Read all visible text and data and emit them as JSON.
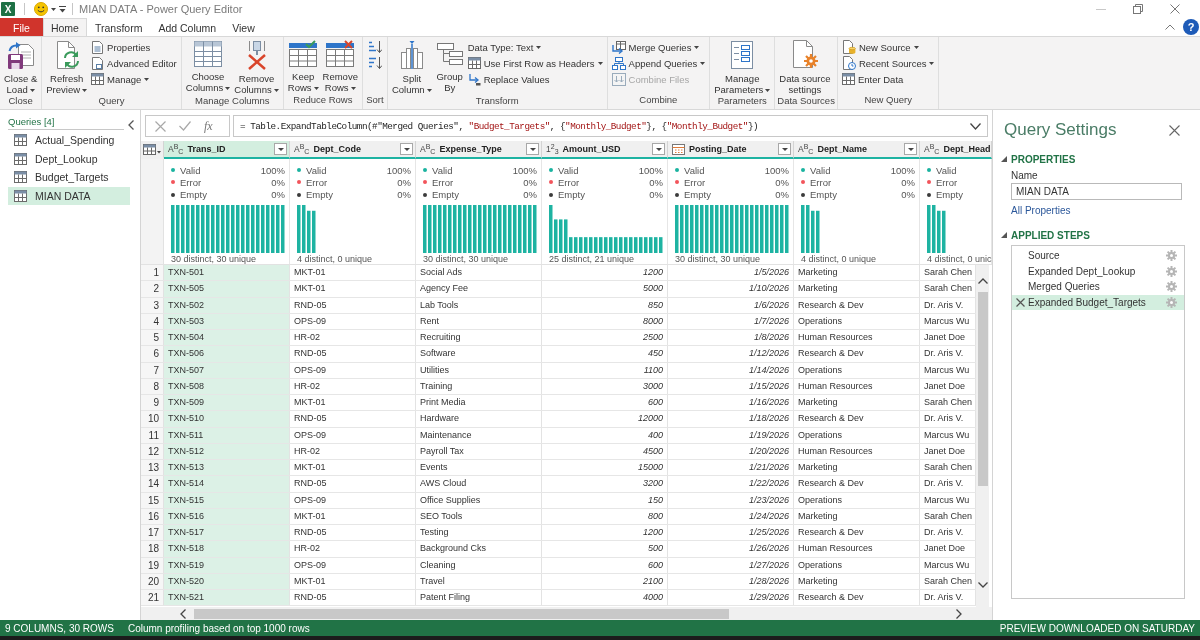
{
  "window": {
    "logo": "X",
    "title": "MIAN DATA - Power Query Editor"
  },
  "tabs": [
    {
      "label": "File",
      "kind": "file",
      "selected": false
    },
    {
      "label": "Home",
      "kind": "tab",
      "selected": true
    },
    {
      "label": "Transform",
      "kind": "tab",
      "selected": false
    },
    {
      "label": "Add Column",
      "kind": "tab",
      "selected": false
    },
    {
      "label": "View",
      "kind": "tab",
      "selected": false
    }
  ],
  "help_button": {
    "label": "?"
  },
  "ribbon": [
    {
      "label": "Close",
      "commands": [
        {
          "kind": "large",
          "label": "Close &\nLoad",
          "dropdown": true,
          "disabled": false
        }
      ]
    },
    {
      "label": "Query",
      "commands": [
        {
          "kind": "large",
          "label": "Refresh\nPreview",
          "dropdown": true,
          "disabled": false
        },
        {
          "kind": "small",
          "label": "Properties",
          "dropdown": false,
          "disabled": false
        },
        {
          "kind": "small",
          "label": "Advanced Editor",
          "dropdown": false,
          "disabled": false
        },
        {
          "kind": "small",
          "label": "Manage",
          "dropdown": true,
          "disabled": false
        }
      ]
    },
    {
      "label": "Manage Columns",
      "commands": [
        {
          "kind": "large",
          "label": "Choose\nColumns",
          "dropdown": true,
          "disabled": false
        },
        {
          "kind": "large",
          "label": "Remove\nColumns",
          "dropdown": true,
          "disabled": false
        }
      ]
    },
    {
      "label": "Reduce Rows",
      "commands": [
        {
          "kind": "large",
          "label": "Keep\nRows",
          "dropdown": true,
          "disabled": false
        },
        {
          "kind": "large",
          "label": "Remove\nRows",
          "dropdown": true,
          "disabled": false
        }
      ]
    },
    {
      "label": "Sort",
      "commands": [
        {
          "kind": "icon",
          "dropdown": false,
          "disabled": false
        },
        {
          "kind": "icon",
          "dropdown": false,
          "disabled": false
        }
      ]
    },
    {
      "label": "Transform",
      "commands": [
        {
          "kind": "large",
          "label": "Split\nColumn",
          "dropdown": true,
          "disabled": false
        },
        {
          "kind": "large",
          "label": "Group\nBy",
          "dropdown": false,
          "disabled": false
        },
        {
          "kind": "small",
          "label": "Data Type: Text",
          "dropdown": true,
          "disabled": false
        },
        {
          "kind": "small",
          "label": "Use First Row as Headers",
          "dropdown": true,
          "disabled": false
        },
        {
          "kind": "small",
          "label": "Replace Values",
          "dropdown": false,
          "disabled": false
        }
      ]
    },
    {
      "label": "Combine",
      "commands": [
        {
          "kind": "small",
          "label": "Merge Queries",
          "dropdown": true,
          "disabled": false
        },
        {
          "kind": "small",
          "label": "Append Queries",
          "dropdown": true,
          "disabled": false
        },
        {
          "kind": "small",
          "label": "Combine Files",
          "dropdown": false,
          "disabled": true
        }
      ]
    },
    {
      "label": "Parameters",
      "commands": [
        {
          "kind": "large",
          "label": "Manage\nParameters",
          "dropdown": true,
          "disabled": false
        }
      ]
    },
    {
      "label": "Data Sources",
      "commands": [
        {
          "kind": "large",
          "label": "Data source\nsettings",
          "dropdown": false,
          "disabled": false
        }
      ]
    },
    {
      "label": "New Query",
      "commands": [
        {
          "kind": "small",
          "label": "New Source",
          "dropdown": true,
          "disabled": false
        },
        {
          "kind": "small",
          "label": "Recent Sources",
          "dropdown": true,
          "disabled": false
        },
        {
          "kind": "small",
          "label": "Enter Data",
          "dropdown": false,
          "disabled": false
        }
      ]
    }
  ],
  "queries": {
    "title": "Queries [4]",
    "items": [
      {
        "label": "Actual_Spending",
        "selected": false
      },
      {
        "label": "Dept_Lookup",
        "selected": false
      },
      {
        "label": "Budget_Targets",
        "selected": false
      },
      {
        "label": "MIAN DATA",
        "selected": true
      }
    ]
  },
  "formula_bar": {
    "function_label": "fx",
    "formula": [
      {
        "kind": "code",
        "text": "= Table.ExpandTableColumn(#\"Merged Queries\", "
      },
      {
        "kind": "string",
        "text": "\"Budget_Targets\""
      },
      {
        "kind": "code",
        "text": ", {"
      },
      {
        "kind": "string",
        "text": "\"Monthly_Budget\""
      },
      {
        "kind": "code",
        "text": "}, {"
      },
      {
        "kind": "string",
        "text": "\"Monthly_Budget\""
      },
      {
        "kind": "code",
        "text": "})"
      }
    ]
  },
  "table": {
    "columns": [
      {
        "name": "Trans_ID",
        "kind": "text",
        "type_label": "A$^{B}$$_{C}$",
        "selected": true,
        "profile": {
          "stats": [
            {
              "label": "Valid",
              "value": "100%",
              "color": "#1ab3a0"
            },
            {
              "label": "Error",
              "value": "0%",
              "color": "#f2545b"
            },
            {
              "label": "Empty",
              "value": "0%",
              "color": "#3b3b3b"
            }
          ],
          "summary": "30 distinct, 30 unique"
        }
      },
      {
        "name": "Dept_Code",
        "kind": "text",
        "type_label": "A$^{B}$$_{C}$",
        "selected": false,
        "profile": {
          "stats": [
            {
              "label": "Valid",
              "value": "100%",
              "color": "#1ab3a0"
            },
            {
              "label": "Error",
              "value": "0%",
              "color": "#f2545b"
            },
            {
              "label": "Empty",
              "value": "0%",
              "color": "#3b3b3b"
            }
          ],
          "summary": "4 distinct, 0 unique"
        }
      },
      {
        "name": "Expense_Type",
        "kind": "text",
        "type_label": "A$^{B}$$_{C}$",
        "selected": false,
        "profile": {
          "stats": [
            {
              "label": "Valid",
              "value": "100%",
              "color": "#1ab3a0"
            },
            {
              "label": "Error",
              "value": "0%",
              "color": "#f2545b"
            },
            {
              "label": "Empty",
              "value": "0%",
              "color": "#3b3b3b"
            }
          ],
          "summary": "30 distinct, 30 unique"
        }
      },
      {
        "name": "Amount_USD",
        "kind": "number",
        "type_label": "1$^{2}$$_{3}$",
        "selected": false,
        "profile": {
          "stats": [
            {
              "label": "Valid",
              "value": "100%",
              "color": "#1ab3a0"
            },
            {
              "label": "Error",
              "value": "0%",
              "color": "#f2545b"
            },
            {
              "label": "Empty",
              "value": "0%",
              "color": "#3b3b3b"
            }
          ],
          "summary": "25 distinct, 21 unique"
        }
      },
      {
        "name": "Posting_Date",
        "kind": "date",
        "selected": false,
        "profile": {
          "stats": [
            {
              "label": "Valid",
              "value": "100%",
              "color": "#1ab3a0"
            },
            {
              "label": "Error",
              "value": "0%",
              "color": "#f2545b"
            },
            {
              "label": "Empty",
              "value": "0%",
              "color": "#3b3b3b"
            }
          ],
          "summary": "30 distinct, 30 unique"
        }
      },
      {
        "name": "Dept_Name",
        "kind": "text",
        "type_label": "A$^{B}$$_{C}$",
        "selected": false,
        "profile": {
          "stats": [
            {
              "label": "Valid",
              "value": "100%",
              "color": "#1ab3a0"
            },
            {
              "label": "Error",
              "value": "0%",
              "color": "#f2545b"
            },
            {
              "label": "Empty",
              "value": "0%",
              "color": "#3b3b3b"
            }
          ],
          "summary": "4 distinct, 0 unique"
        }
      },
      {
        "name": "Dept_Head",
        "kind": "text",
        "type_label": "A$^{B}$$_{C}$",
        "selected": false,
        "profile": {
          "stats": [
            {
              "label": "Valid",
              "color": "#1ab3a0"
            },
            {
              "label": "Error",
              "color": "#f2545b"
            },
            {
              "label": "Empty",
              "color": "#3b3b3b"
            }
          ],
          "summary": "4 distinct, 0 unic"
        }
      }
    ],
    "rows": [
      {
        "number": "1",
        "cells": [
          "TXN-501",
          "MKT-01",
          "Social Ads",
          "1200",
          "1/5/2026",
          "Marketing",
          "Sarah Chen"
        ]
      },
      {
        "number": "2",
        "cells": [
          "TXN-505",
          "MKT-01",
          "Agency Fee",
          "5000",
          "1/10/2026",
          "Marketing",
          "Sarah Chen"
        ]
      },
      {
        "number": "3",
        "cells": [
          "TXN-502",
          "RND-05",
          "Lab Tools",
          "850",
          "1/6/2026",
          "Research & Dev",
          "Dr. Aris V."
        ]
      },
      {
        "number": "4",
        "cells": [
          "TXN-503",
          "OPS-09",
          "Rent",
          "8000",
          "1/7/2026",
          "Operations",
          "Marcus Wu"
        ]
      },
      {
        "number": "5",
        "cells": [
          "TXN-504",
          "HR-02",
          "Recruiting",
          "2500",
          "1/8/2026",
          "Human Resources",
          "Janet Doe"
        ]
      },
      {
        "number": "6",
        "cells": [
          "TXN-506",
          "RND-05",
          "Software",
          "450",
          "1/12/2026",
          "Research & Dev",
          "Dr. Aris V."
        ]
      },
      {
        "number": "7",
        "cells": [
          "TXN-507",
          "OPS-09",
          "Utilities",
          "1100",
          "1/14/2026",
          "Operations",
          "Marcus Wu"
        ]
      },
      {
        "number": "8",
        "cells": [
          "TXN-508",
          "HR-02",
          "Training",
          "3000",
          "1/15/2026",
          "Human Resources",
          "Janet Doe"
        ]
      },
      {
        "number": "9",
        "cells": [
          "TXN-509",
          "MKT-01",
          "Print Media",
          "600",
          "1/16/2026",
          "Marketing",
          "Sarah Chen"
        ]
      },
      {
        "number": "10",
        "cells": [
          "TXN-510",
          "RND-05",
          "Hardware",
          "12000",
          "1/18/2026",
          "Research & Dev",
          "Dr. Aris V."
        ]
      },
      {
        "number": "11",
        "cells": [
          "TXN-511",
          "OPS-09",
          "Maintenance",
          "400",
          "1/19/2026",
          "Operations",
          "Marcus Wu"
        ]
      },
      {
        "number": "12",
        "cells": [
          "TXN-512",
          "HR-02",
          "Payroll Tax",
          "4500",
          "1/20/2026",
          "Human Resources",
          "Janet Doe"
        ]
      },
      {
        "number": "13",
        "cells": [
          "TXN-513",
          "MKT-01",
          "Events",
          "15000",
          "1/21/2026",
          "Marketing",
          "Sarah Chen"
        ]
      },
      {
        "number": "14",
        "cells": [
          "TXN-514",
          "RND-05",
          "AWS Cloud",
          "3200",
          "1/22/2026",
          "Research & Dev",
          "Dr. Aris V."
        ]
      },
      {
        "number": "15",
        "cells": [
          "TXN-515",
          "OPS-09",
          "Office Supplies",
          "150",
          "1/23/2026",
          "Operations",
          "Marcus Wu"
        ]
      },
      {
        "number": "16",
        "cells": [
          "TXN-516",
          "MKT-01",
          "SEO Tools",
          "800",
          "1/24/2026",
          "Marketing",
          "Sarah Chen"
        ]
      },
      {
        "number": "17",
        "cells": [
          "TXN-517",
          "RND-05",
          "Testing",
          "1200",
          "1/25/2026",
          "Research & Dev",
          "Dr. Aris V."
        ]
      },
      {
        "number": "18",
        "cells": [
          "TXN-518",
          "HR-02",
          "Background Cks",
          "500",
          "1/26/2026",
          "Human Resources",
          "Janet Doe"
        ]
      },
      {
        "number": "19",
        "cells": [
          "TXN-519",
          "OPS-09",
          "Cleaning",
          "600",
          "1/27/2026",
          "Operations",
          "Marcus Wu"
        ]
      },
      {
        "number": "20",
        "cells": [
          "TXN-520",
          "MKT-01",
          "Travel",
          "2100",
          "1/28/2026",
          "Marketing",
          "Sarah Chen"
        ]
      },
      {
        "number": "21",
        "cells": [
          "TXN-521",
          "RND-05",
          "Patent Filing",
          "4000",
          "1/29/2026",
          "Research & Dev",
          "Dr. Aris V."
        ]
      }
    ]
  },
  "query_settings": {
    "title": "Query Settings",
    "properties": {
      "heading": "PROPERTIES",
      "expanded": true,
      "name_label": "Name",
      "name_value": "MIAN DATA",
      "link": "All Properties"
    },
    "applied_steps": {
      "heading": "APPLIED STEPS",
      "expanded": true,
      "steps": [
        {
          "label": "Source",
          "selected": false
        },
        {
          "label": "Expanded Dept_Lookup",
          "selected": false
        },
        {
          "label": "Merged Queries",
          "selected": false
        },
        {
          "label": "Expanded Budget_Targets",
          "selected": true
        }
      ]
    }
  },
  "status_bar": {
    "summary": "9 COLUMNS, 30 ROWS",
    "profiling": "Column profiling based on top 1000 rows",
    "preview": "PREVIEW DOWNLOADED ON SATURDAY"
  }
}
